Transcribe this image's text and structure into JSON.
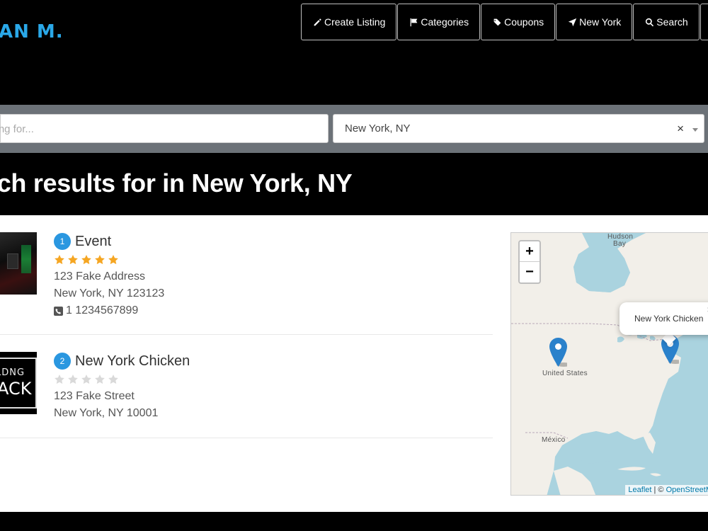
{
  "header": {
    "logo": "AN M.",
    "nav": [
      {
        "label": "Create Listing",
        "icon": "pencil-icon"
      },
      {
        "label": "Categories",
        "icon": "flag-icon"
      },
      {
        "label": "Coupons",
        "icon": "tags-icon"
      },
      {
        "label": "New York",
        "icon": "location-arrow-icon"
      },
      {
        "label": "Search",
        "icon": "search-icon"
      },
      {
        "label": "",
        "icon": "user-icon"
      }
    ]
  },
  "search": {
    "placeholder": "king for...",
    "location_value": "New York, NY",
    "clear_label": "×"
  },
  "results_title": "rch results for in New York, NY",
  "listings": [
    {
      "number": "1",
      "name": "Event",
      "rating": 5,
      "address": "123 Fake Address",
      "city": "New York, NY 123123",
      "phone": "1 1234567899"
    },
    {
      "number": "2",
      "name": "New York Chicken",
      "rating": 0,
      "address": "123 Fake Street",
      "city": "New York, NY 10001",
      "phone": ""
    }
  ],
  "thumb2_text": {
    "top": "LDNG",
    "bottom": "ACK"
  },
  "map": {
    "zoom_in": "+",
    "zoom_out": "−",
    "popup_text": "New York Chicken",
    "popup_close": "×",
    "labels": {
      "hudson": "Hudson",
      "bay": "Bay",
      "us": "United States",
      "mexico": "México"
    },
    "attribution_leaflet": "Leaflet",
    "attribution_sep": " | © ",
    "attribution_osm": "OpenStreetM"
  },
  "colors": {
    "accent": "#2a97e0",
    "logo": "#2aa8e8",
    "star_gold": "#f5a623",
    "star_empty": "#d9d9d9",
    "searchbar_bg": "#6c7278"
  }
}
